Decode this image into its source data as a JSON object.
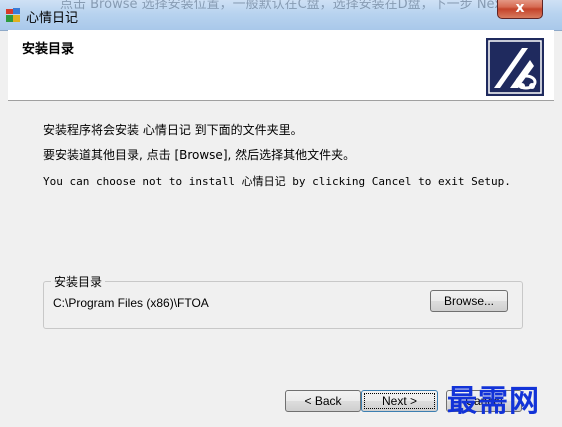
{
  "window": {
    "title": "心情日记",
    "close_label": "x",
    "background_text": "点击 Browse 选择安装位置，一般默认在C盘，选择安装在D盘，下一步 Next"
  },
  "header": {
    "title": "安装目录"
  },
  "content": {
    "line1": "安装程序将会安装 心情日记 到下面的文件夹里。",
    "line2": "要安装道其他目录, 点击 [Browse], 然后选择其他文件夹。",
    "line3": "You can choose not to install 心情日记 by clicking Cancel to exit Setup."
  },
  "install_dir": {
    "group_label": "安装目录",
    "path": "C:\\Program Files (x86)\\FTOA",
    "browse_label": "Browse..."
  },
  "buttons": {
    "back_label": "< Back",
    "next_label": "Next >",
    "cancel_label": "Cancel"
  },
  "watermark": {
    "text": "最需网"
  },
  "colors": {
    "header_bg": "#ffffff",
    "dialog_bg": "#f0f0f0",
    "logo_bg": "#1f2a5e",
    "watermark": "#1233d8"
  }
}
